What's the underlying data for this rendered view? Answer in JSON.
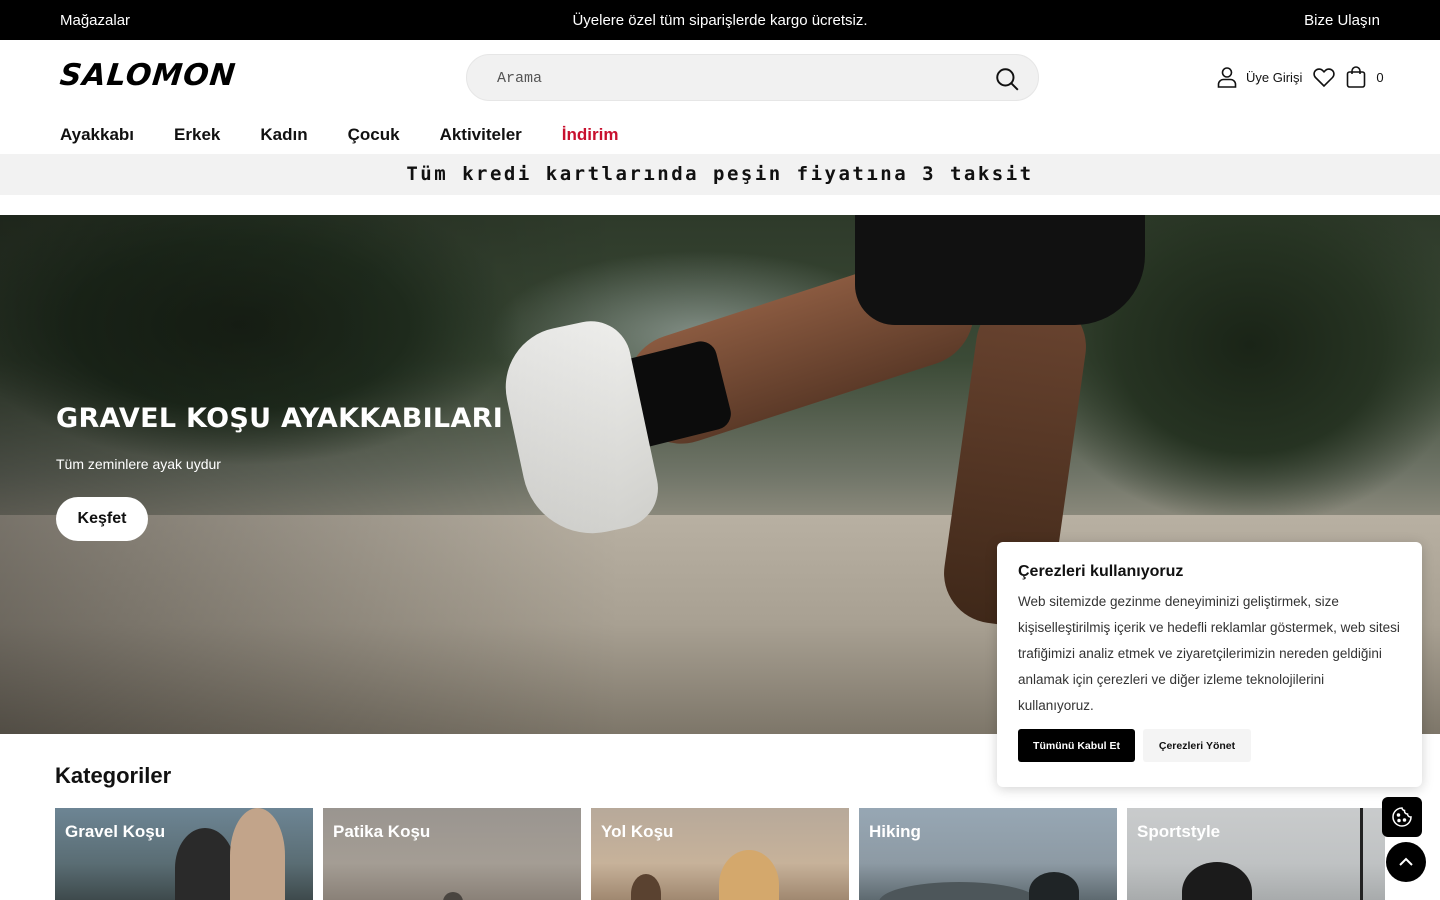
{
  "topbar": {
    "stores": "Mağazalar",
    "announcement": "Üyelere özel tüm siparişlerde kargo ücretsiz.",
    "contact": "Bize Ulaşın"
  },
  "header": {
    "logo": "SALOMON",
    "search_placeholder": "Arama",
    "login_label": "Üye Girişi",
    "cart_count": "0"
  },
  "nav": {
    "items": [
      "Ayakkabı",
      "Erkek",
      "Kadın",
      "Çocuk",
      "Aktiviteler",
      "İndirim"
    ],
    "sale_color": "#c8102e"
  },
  "promo": {
    "text": "Tüm kredi kartlarında peşin fiyatına 3 taksit"
  },
  "hero": {
    "title": "GRAVEL KOŞU AYAKKABILARI",
    "subtitle": "Tüm zeminlere ayak uydur",
    "cta": "Keşfet"
  },
  "categories": {
    "title": "Kategoriler",
    "items": [
      {
        "label": "Gravel Koşu"
      },
      {
        "label": "Patika Koşu"
      },
      {
        "label": "Yol Koşu"
      },
      {
        "label": "Hiking"
      },
      {
        "label": "Sportstyle"
      }
    ]
  },
  "cookie": {
    "title": "Çerezleri kullanıyoruz",
    "body": "Web sitemizde gezinme deneyiminizi geliştirmek, size kişiselleştirilmiş içerik ve hedefli reklamlar göstermek, web sitesi trafiğimizi analiz etmek ve ziyaretçilerimizin nereden geldiğini anlamak için çerezleri ve diğer izleme teknolojilerini kullanıyoruz.",
    "accept": "Tümünü Kabul Et",
    "manage": "Çerezleri Yönet"
  },
  "icons": {
    "search": "search-icon",
    "user": "user-icon",
    "wishlist": "heart-icon",
    "cart": "shopping-bag-icon",
    "cookie_settings": "cookie-icon",
    "scroll_top": "chevron-up-icon"
  }
}
